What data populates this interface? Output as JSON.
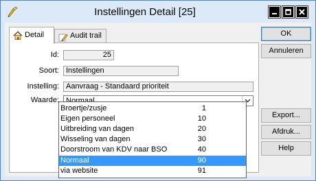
{
  "window": {
    "title": "Instellingen Detail [25]"
  },
  "tabs": [
    {
      "label": "Detail",
      "icon": "house-icon",
      "active": true
    },
    {
      "label": "Audit trail",
      "icon": "pencil-icon",
      "active": false
    }
  ],
  "form": {
    "id_label": "Id:",
    "id_value": "25",
    "soort_label": "Soort:",
    "soort_value": "Instellingen",
    "instelling_label": "Instelling:",
    "instelling_value": "Aanvraag - Standaard prioriteit",
    "waarde_label": "Waarde:",
    "waarde_value": "Normaal"
  },
  "dropdown": {
    "selected_index": 5,
    "options": [
      {
        "label": "Broertje/zusje",
        "code": "1"
      },
      {
        "label": "Eigen personeel",
        "code": "10"
      },
      {
        "label": "Uitbreiding van dagen",
        "code": "20"
      },
      {
        "label": "Wisseling van dagen",
        "code": "30"
      },
      {
        "label": "Doorstroom van KDV naar BSO",
        "code": "40"
      },
      {
        "label": "Normaal",
        "code": "90"
      },
      {
        "label": "via website",
        "code": "91"
      }
    ]
  },
  "buttons": {
    "ok": "OK",
    "annuleren": "Annuleren",
    "export": "Export...",
    "afdruk": "Afdruk...",
    "help": "Help"
  },
  "colors": {
    "titlebar": "#dbe9f8",
    "selection": "#3399ff"
  }
}
